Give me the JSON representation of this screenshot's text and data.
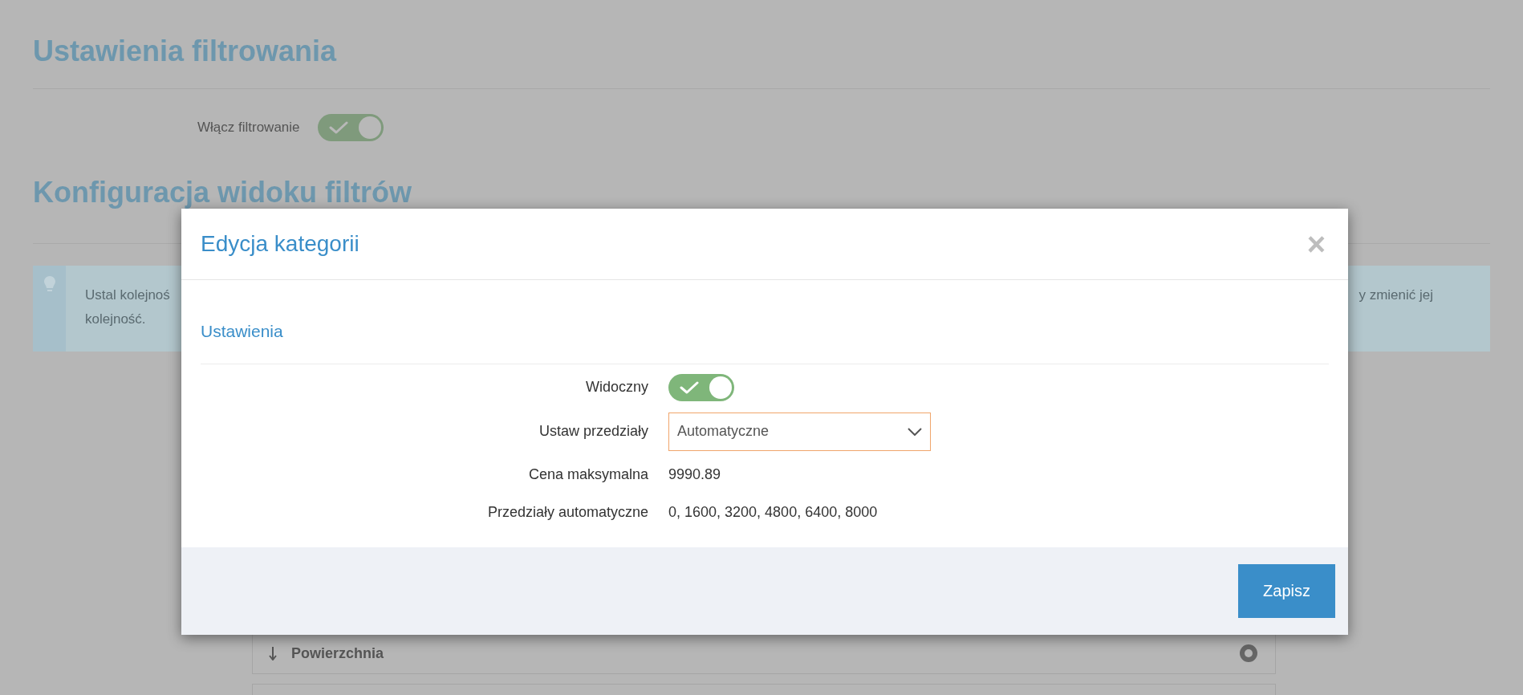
{
  "page": {
    "title": "Ustawienia filtrowania",
    "filter_toggle": {
      "label": "Włącz filtrowanie",
      "on": true
    },
    "section_title": "Konfiguracja widoku filtrów",
    "info": {
      "left_lines": [
        "Ustal kolejnoś",
        "kolejność."
      ],
      "right_lines": [
        "y zmienić jej"
      ]
    },
    "rows": [
      {
        "label": "Powierzchnia"
      },
      {}
    ]
  },
  "dialog": {
    "title": "Edycja kategorii",
    "close": "×",
    "section": "Ustawienia",
    "fields": [
      {
        "kind": "toggle",
        "label": "Widoczny",
        "on": true
      },
      {
        "kind": "select",
        "label": "Ustaw przedziały",
        "value": "Automatyczne"
      },
      {
        "kind": "text",
        "label": "Cena maksymalna",
        "value": "9990.89"
      },
      {
        "kind": "text",
        "label": "Przedziały automatyczne",
        "value": "0, 1600, 3200, 4800, 6400, 8000"
      }
    ],
    "save": "Zapisz"
  }
}
